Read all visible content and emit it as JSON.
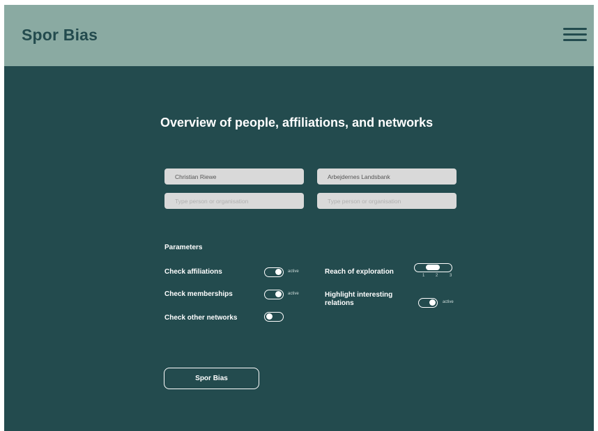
{
  "header": {
    "logo": "Spor Bias",
    "menu_icon": "hamburger-menu-icon"
  },
  "main": {
    "title": "Overview of people, affiliations, and networks",
    "inputs": [
      {
        "value": "Christian Riewe",
        "placeholder": ""
      },
      {
        "value": "Arbejdernes Landsbank",
        "placeholder": ""
      },
      {
        "value": "",
        "placeholder": "Type person or organisation"
      },
      {
        "value": "",
        "placeholder": "Type person or organisation"
      }
    ],
    "parameters": {
      "title": "Parameters",
      "check_affiliations": {
        "label": "Check affiliations",
        "active": true,
        "status": "active"
      },
      "check_memberships": {
        "label": "Check memberships",
        "active": true,
        "status": "active"
      },
      "check_other_networks": {
        "label": "Check other networks",
        "active": false
      },
      "reach": {
        "label": "Reach of exploration",
        "ticks": [
          "1",
          "2",
          "3"
        ],
        "value": 2
      },
      "highlight": {
        "label_line1": "Highlight interesting",
        "label_line2": "relations",
        "active": true,
        "status": "active"
      }
    },
    "submit_label": "Spor Bias"
  },
  "colors": {
    "header_bg": "#8aaaa2",
    "main_bg": "#234b4e",
    "input_bg": "#d9d9d9",
    "text": "#ffffff"
  }
}
